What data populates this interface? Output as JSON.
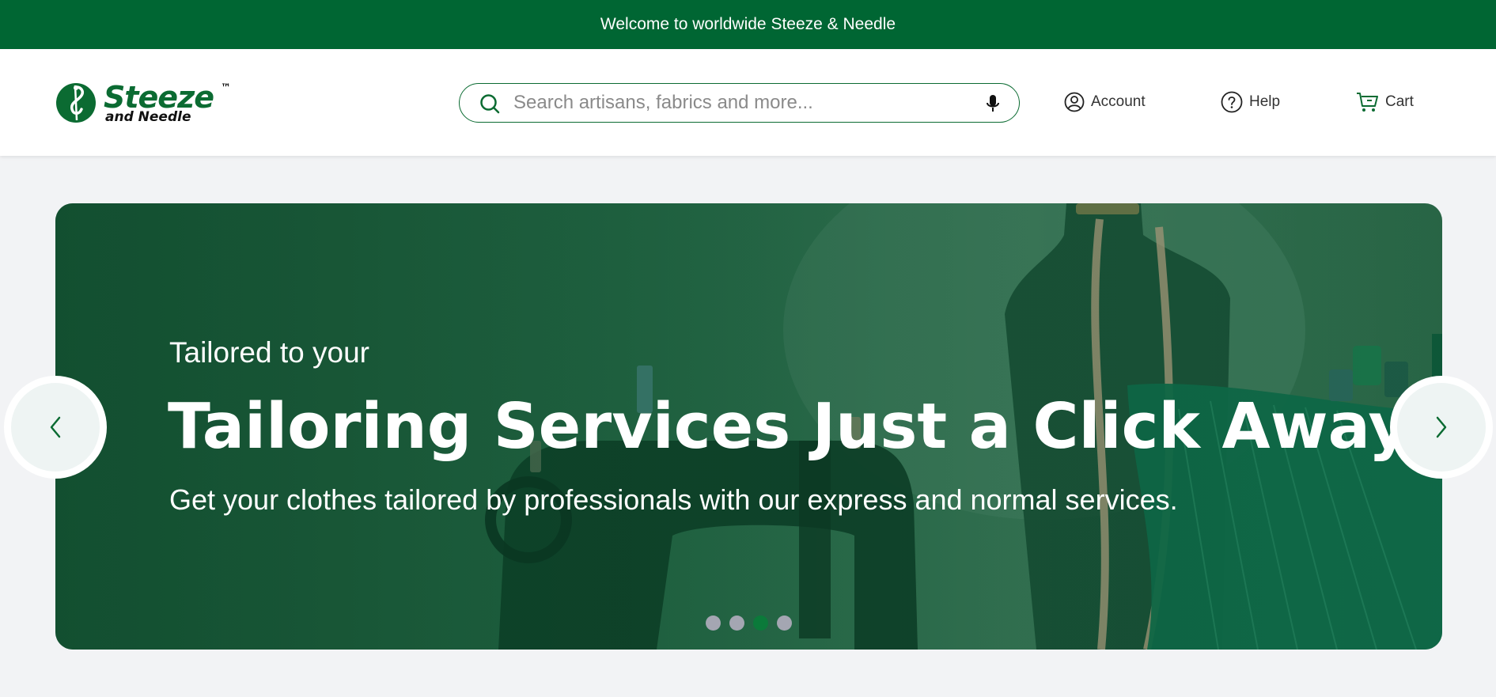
{
  "topbar": {
    "text": "Welcome to worldwide Steeze & Needle"
  },
  "logo": {
    "name": "Steeze",
    "tm": "™",
    "sub": "and Needle"
  },
  "search": {
    "placeholder": "Search artisans, fabrics and more...",
    "value": "",
    "icon": "search-icon",
    "mic_icon": "microphone-icon"
  },
  "nav": [
    {
      "label": "Account",
      "icon": "user-circle-icon"
    },
    {
      "label": "Help",
      "icon": "question-circle-icon"
    },
    {
      "label": "Cart",
      "icon": "cart-icon"
    }
  ],
  "hero": {
    "pre": "Tailored to your",
    "title": "Tailoring Services Just a Click Away",
    "subtitle": "Get your clothes tailored by professionals with our express and normal services.",
    "slides": 4,
    "active_slide": 3
  },
  "colors": {
    "brand": "#006633",
    "accent": "#0b7a3a",
    "dot_inactive": "#a4a6b2"
  }
}
